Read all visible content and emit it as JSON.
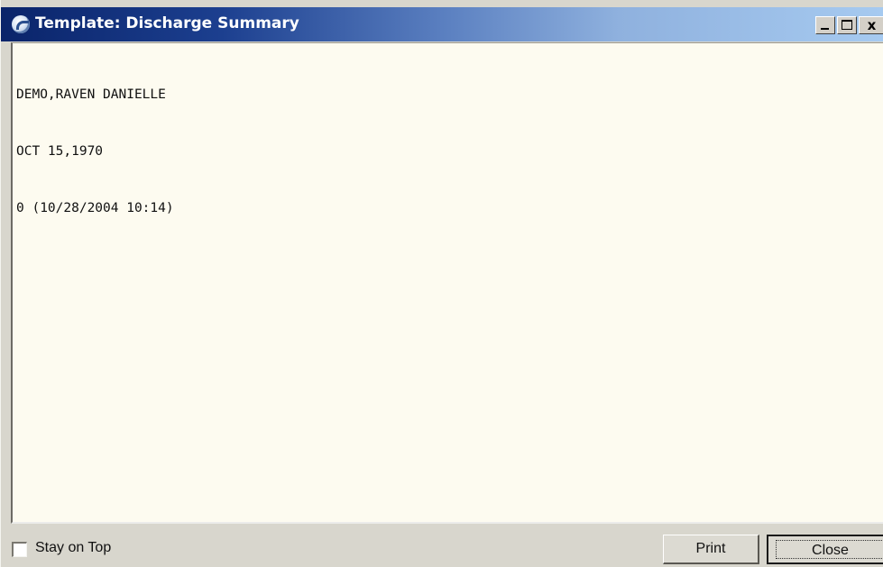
{
  "window": {
    "title": "Template: Discharge Summary",
    "controls": {
      "minimize_label": "_",
      "maximize_label": "□",
      "close_label": "x"
    }
  },
  "content": {
    "lines": [
      "DEMO,RAVEN DANIELLE",
      "OCT 15,1970",
      "0 (10/28/2004 10:14)"
    ]
  },
  "footer": {
    "stay_on_top_label": "Stay on Top",
    "stay_on_top_checked": false,
    "print_label": "Print",
    "close_label": "Close"
  },
  "colors": {
    "title_gradient_start": "#0a246a",
    "title_gradient_end": "#a6caf0",
    "content_background": "#fdfbf0",
    "window_face": "#d8d6cd"
  },
  "icons": {
    "title": "app-logo-icon"
  }
}
